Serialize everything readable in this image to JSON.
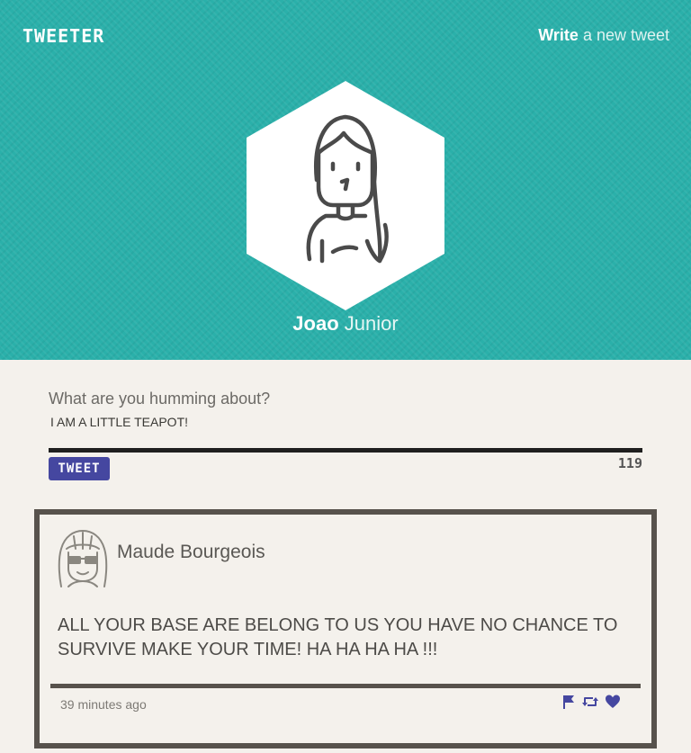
{
  "nav": {
    "logo": "TWEETER",
    "compose_link_strong": "Write",
    "compose_link_rest": " a new tweet"
  },
  "profile": {
    "first_name": "Joao",
    "last_name": " Junior",
    "avatar_icon": "woman-avatar-icon"
  },
  "composer": {
    "prompt": "What are you humming about?",
    "input_value": "I AM A LITTLE TEAPOT!",
    "tweet_button": "TWEET",
    "chars_left": "119"
  },
  "tweets": [
    {
      "author": "Maude Bourgeois",
      "avatar_icon": "sunglasses-avatar-icon",
      "text": "ALL YOUR BASE ARE BELONG TO US YOU HAVE NO CHANCE TO SURVIVE MAKE YOUR TIME! HA HA HA HA !!!",
      "time": "39 minutes ago",
      "actions": [
        "flag-icon",
        "retweet-icon",
        "heart-icon"
      ]
    }
  ],
  "colors": {
    "header_bg": "#2ab0aa",
    "accent": "#4547a0",
    "page_bg": "#f4f1ec",
    "card_border": "#57524c"
  }
}
